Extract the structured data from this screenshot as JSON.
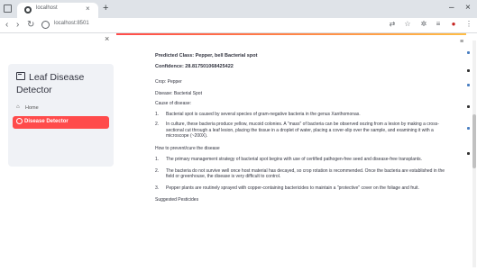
{
  "browser": {
    "tab_title": "localhost",
    "url": "localhost:8501",
    "new_tab": "+",
    "tab_close": "×",
    "minimize": "–",
    "close": "×",
    "back": "‹",
    "forward": "›",
    "reload": "↻"
  },
  "sidebar": {
    "close_glyph": "×",
    "app_title": "Leaf Disease Detector",
    "nav": [
      {
        "label": "Home",
        "icon": "home-icon"
      },
      {
        "label": "Disease Detector",
        "icon": "circle-icon",
        "active": true
      }
    ]
  },
  "main": {
    "predicted": "Predicted Class: Pepper, bell Bacterial spot",
    "confidence": "Confidence: 28.817501068425422",
    "crop": "Crop: Pepper",
    "disease": "Disease: Bacterial Spot",
    "cause_header": "Cause of disease:",
    "causes": [
      "Bacterial spot is caused by several species of gram-negative bacteria in the genus Xanthomonas.",
      "In culture, these bacteria produce yellow, mucoid colonies. A \"mass\" of bacteria can be observed oozing from a lesion by making a cross-sectional cut through a leaf lesion, placing the tissue in a droplet of water, placing a cover-slip over the sample, and examining it with a microscope (~200X)."
    ],
    "prevent_header": "How to prevent/cure the disease",
    "prevent": [
      "The primary management strategy of bacterial spot begins with use of certified pathogen-free seed and disease-free transplants.",
      "The bacteria do not survive well once host material has decayed, so crop rotation is recommended. Once the bacteria are established in the field or greenhouse, the disease is very difficult to control.",
      "Pepper plants are routinely sprayed with copper-containing bactericides to maintain a \"protective\" cover on the foliage and fruit."
    ],
    "suggest_header": "Suggested Pesticides"
  },
  "colors": {
    "accent": "#ff4b4b",
    "sidebar_bg": "#f0f2f6",
    "text": "#31333f"
  }
}
